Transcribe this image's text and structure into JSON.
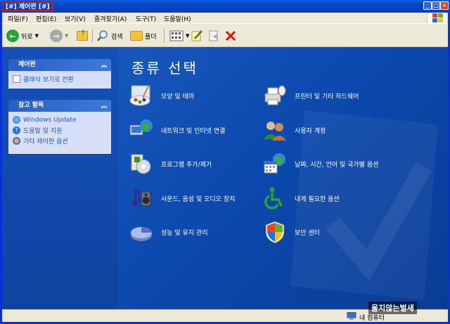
{
  "window": {
    "title": "[#] 제어판 [#]"
  },
  "menu": [
    "파일(F)",
    "편집(E)",
    "보기(V)",
    "즐겨찾기(A)",
    "도구(T)",
    "도움말(H)"
  ],
  "toolbar": {
    "back_label": "뒤로",
    "search_label": "검색",
    "folders_label": "폴더"
  },
  "sidebar": {
    "control_panel": {
      "title": "제어판",
      "switch_label": "클래식 보기로 전환"
    },
    "see_also": {
      "title": "참고 항목",
      "links": [
        "Windows Update",
        "도움말 및 지원",
        "기타 제어판 옵션"
      ]
    }
  },
  "content": {
    "title": "종류 선택",
    "categories": [
      {
        "label": "모양 및 테마",
        "icon": "appearance-themes-icon"
      },
      {
        "label": "프린터 및 기타 하드웨어",
        "icon": "printer-icon"
      },
      {
        "label": "네트워크 및 인터넷 연결",
        "icon": "network-icon"
      },
      {
        "label": "사용자 계정",
        "icon": "user-accounts-icon"
      },
      {
        "label": "프로그램 추가/제거",
        "icon": "add-remove-programs-icon"
      },
      {
        "label": "날짜, 시간, 언어 및 국가별 옵션",
        "icon": "date-time-icon"
      },
      {
        "label": "사운드, 음성 및 오디오 장치",
        "icon": "sound-icon"
      },
      {
        "label": "내게 필요한 옵션",
        "icon": "accessibility-icon"
      },
      {
        "label": "성능 및 유지 관리",
        "icon": "performance-icon"
      },
      {
        "label": "보안 센터",
        "icon": "security-center-icon"
      }
    ]
  },
  "status": {
    "location": "내 컴퓨터"
  },
  "watermark": "울지않는벌새"
}
